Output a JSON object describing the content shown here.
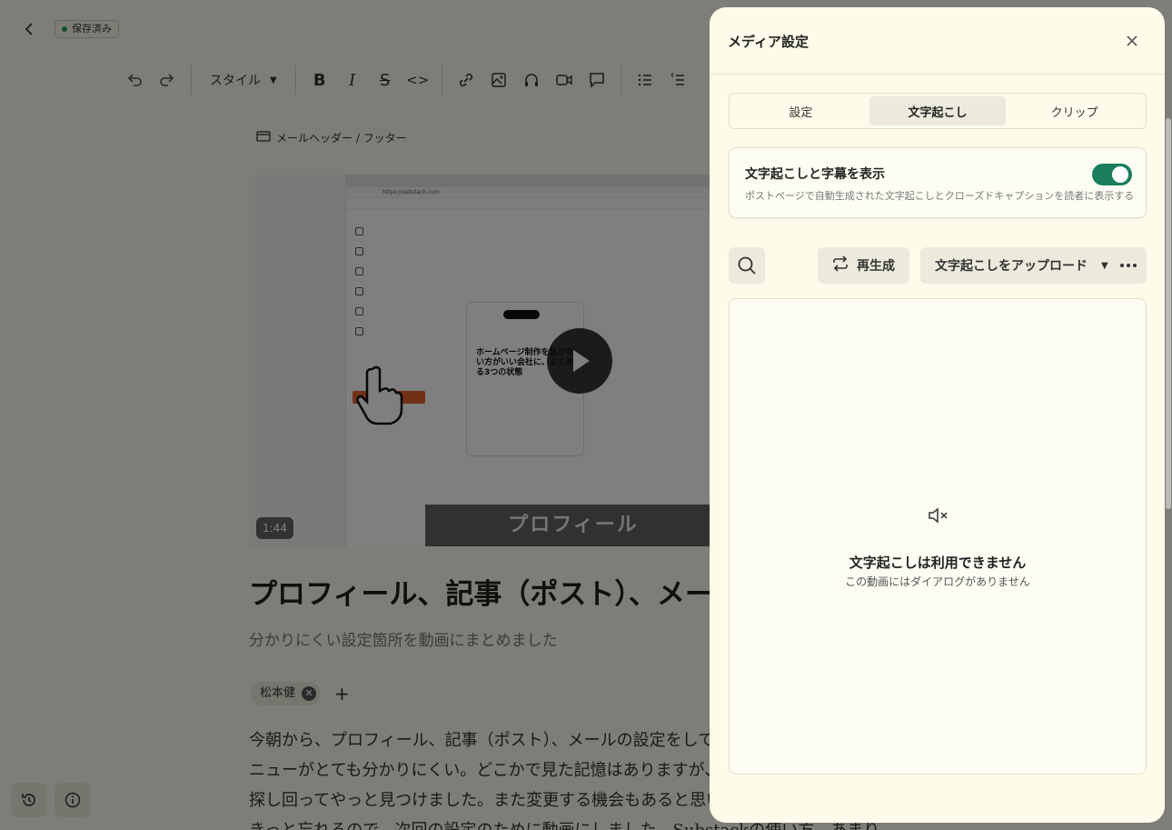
{
  "editor": {
    "saved_badge": "保存済み",
    "toolbar": {
      "style_label": "スタイル"
    },
    "mail_header_link": "メールヘッダー / フッター",
    "video": {
      "duration": "1:44",
      "caption": "プロフィール",
      "browser_url": "https://substack.com",
      "phone_title": "ホームページ制作を急がない方がいい会社に、よくある3つの状態"
    },
    "title": "プロフィール、記事（ポスト）、メールの設定",
    "subtitle": "分かりにくい設定箇所を動画にまとめました",
    "author": "松本健",
    "body_lines": [
      "今朝から、プロフィール、記事（ポスト）、メールの設定をしていましたが、メ",
      "ニューがとても分かりにくい。どこかで見た記憶はありますが、どこだったか",
      "探し回ってやっと見つけました。また変更する機会もあると思いますが、",
      "きっと忘れるので、次回の設定のために動画にしました。Substackの使い方、あまり"
    ]
  },
  "panel": {
    "title": "メディア設定",
    "tabs": [
      {
        "label": "設定",
        "active": false
      },
      {
        "label": "文字起こし",
        "active": true
      },
      {
        "label": "クリップ",
        "active": false
      }
    ],
    "toggle": {
      "title": "文字起こしと字幕を表示",
      "description": "ポストページで自動生成された文字起こしとクローズドキャプションを読者に表示する",
      "on": true
    },
    "actions": {
      "regenerate_label": "再生成",
      "upload_label": "文字起こしをアップロード"
    },
    "empty_state": {
      "title": "文字起こしは利用できません",
      "subtitle": "この動画にはダイアログがありません"
    }
  },
  "colors": {
    "toggle_on": "#1a7f5a",
    "saved_dot": "#21a35f",
    "panel_bg": "#fdfbe9"
  },
  "icons": [
    "back-icon",
    "undo-icon",
    "redo-icon",
    "bold-icon",
    "italic-icon",
    "strikethrough-icon",
    "code-icon",
    "link-icon",
    "image-icon",
    "audio-icon",
    "video-icon",
    "comment-icon",
    "bullet-list-icon",
    "numbered-list-icon",
    "close-icon",
    "search-icon",
    "regenerate-icon",
    "more-icon",
    "muted-speaker-icon",
    "history-icon",
    "info-icon"
  ]
}
